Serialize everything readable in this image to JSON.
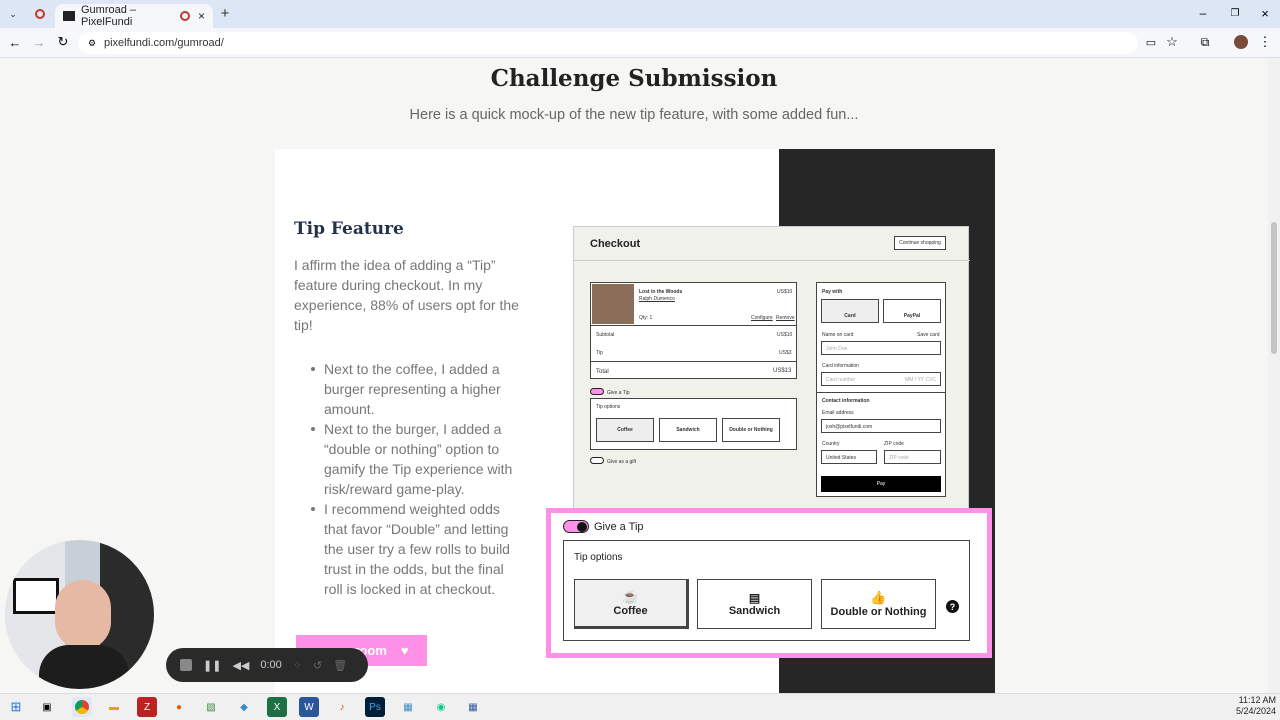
{
  "browser": {
    "tab_title": "Gumroad – PixelFundi",
    "url": "pixelfundi.com/gumroad/"
  },
  "page": {
    "heading": "Challenge Submission",
    "subheading": "Here is a quick mock-up of the new tip feature, with some added fun...",
    "tip_title": "Tip Feature",
    "intro": "I affirm the idea of adding a “Tip” feature during checkout. In my experience, 88% of users opt for the tip!",
    "bullets": [
      "Next to the coffee, I added a burger representing a higher amount.",
      "Next to the burger, I added a “double or nothing” option to gamify the Tip experience with risk/reward game-play.",
      "I recommend weighted odds that favor “Double” and letting the user try a few rolls to build trust in the odds, but the final roll is locked in at checkout."
    ],
    "join_button": "room"
  },
  "mockup": {
    "title": "Checkout",
    "continue": "Continue shopping",
    "product_name": "Lost in the Woods",
    "product_author": "Ralph Dumenco",
    "product_price": "US$10",
    "qty": "Qty: 1",
    "configure": "Configure",
    "remove": "Remove",
    "subtotal_label": "Subtotal",
    "subtotal": "US$10",
    "tip_label": "Tip",
    "tip": "US$3",
    "total_label": "Total",
    "total": "US$13",
    "give_tip": "Give a Tip",
    "tip_options": "Tip options",
    "give_gift": "Give as a gift",
    "pay_with": "Pay with",
    "card": "Card",
    "paypal": "PayPal",
    "name_on_card": "Name on card",
    "save_card": "Save card",
    "name_placeholder": "John Doe",
    "card_info": "Card information",
    "card_number": "Card number",
    "mm_yy": "MM / YY CVC",
    "contact_info": "Contact information",
    "email_label": "Email address",
    "email": "josh@pixelfundi.com",
    "country_label": "Country",
    "country": "United States",
    "zip_label": "ZIP code",
    "zip_placeholder": "ZIP code",
    "pay": "Pay"
  },
  "tip_widget": {
    "give_tip": "Give a Tip",
    "tip_options": "Tip options",
    "options": [
      "Coffee",
      "Sandwich",
      "Double or Nothing"
    ],
    "help": "?"
  },
  "recorder": {
    "time": "0:00"
  },
  "clock": {
    "time": "11:12 AM",
    "date": "5/24/2024"
  },
  "colors": {
    "accent": "#ff90e8",
    "dark": "#262626"
  }
}
